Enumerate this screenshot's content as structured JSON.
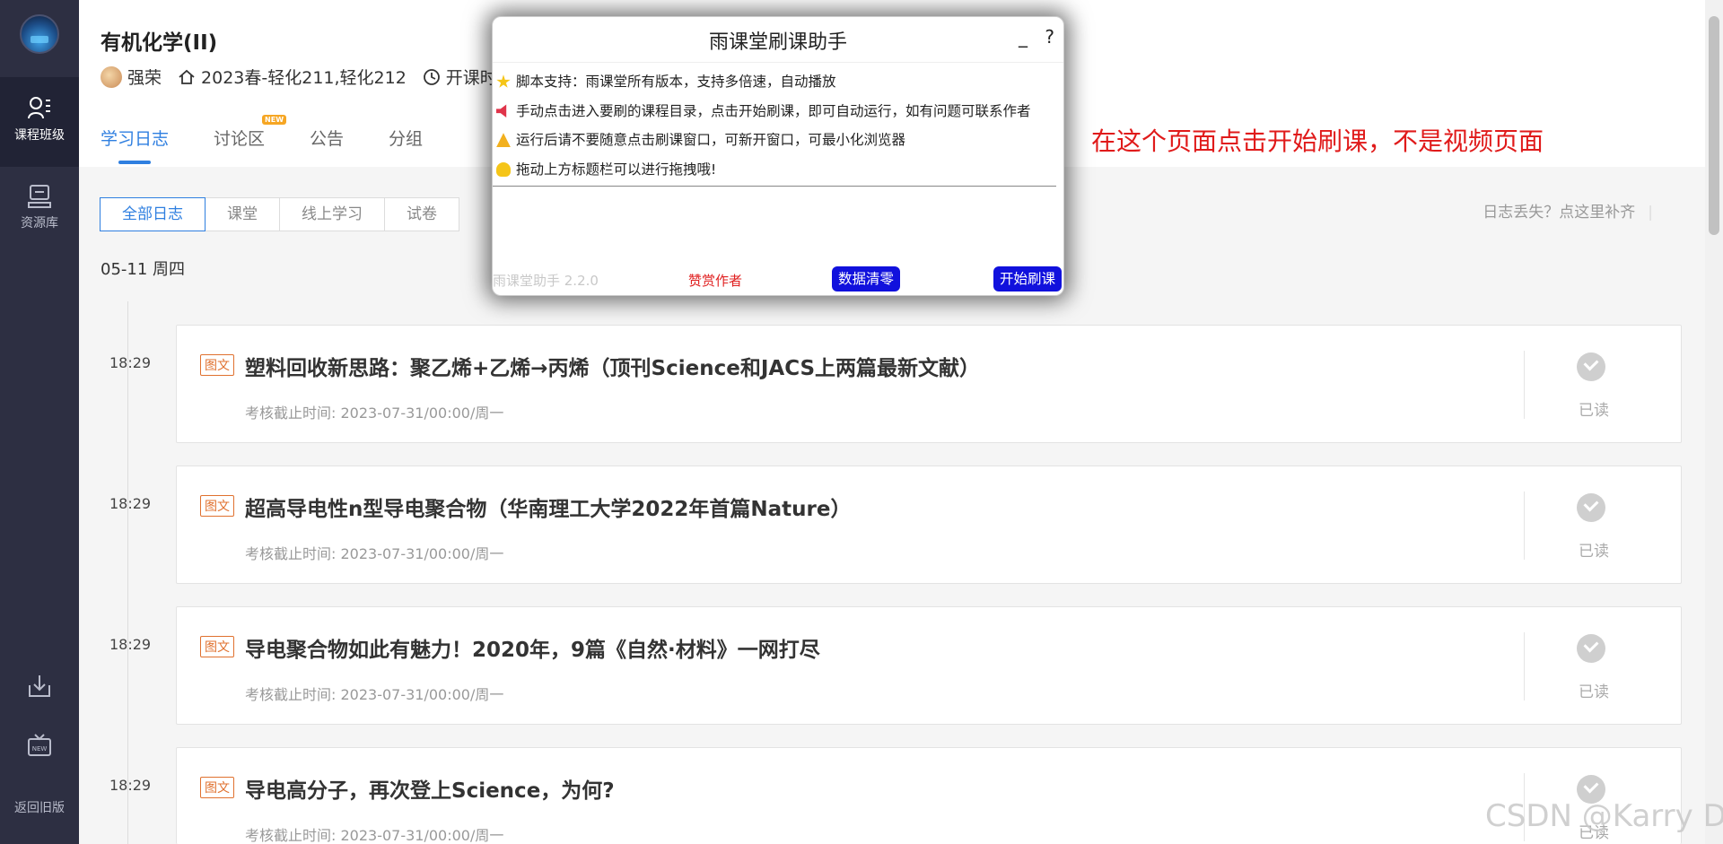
{
  "sidebar": {
    "items": [
      {
        "label": "课程班级",
        "icon": "class-icon"
      },
      {
        "label": "资源库",
        "icon": "resource-icon"
      },
      {
        "label": "",
        "icon": "download-icon"
      },
      {
        "label": "",
        "icon": "new-icon"
      },
      {
        "label": "返回旧版",
        "icon": ""
      }
    ]
  },
  "header": {
    "course_title": "有机化学(II)",
    "teacher": "强荣",
    "classes": "2023春-轻化211,轻化212",
    "status": "开课时"
  },
  "tabs": [
    "学习日志",
    "讨论区",
    "公告",
    "分组"
  ],
  "tab_badge": "NEW",
  "filters": [
    "全部日志",
    "课堂",
    "线上学习",
    "试卷"
  ],
  "lost_link": "日志丢失？点这里补齐",
  "date_label": "05-11 周四",
  "entries": [
    {
      "time": "18:29",
      "tag": "图文",
      "title": "塑料回收新思路：聚乙烯+乙烯→丙烯（顶刊Science和JACS上两篇最新文献）",
      "deadline": "考核截止时间:   2023-07-31/00:00/周一",
      "status": "已读"
    },
    {
      "time": "18:29",
      "tag": "图文",
      "title": "超高导电性n型导电聚合物（华南理工大学2022年首篇Nature）",
      "deadline": "考核截止时间:   2023-07-31/00:00/周一",
      "status": "已读"
    },
    {
      "time": "18:29",
      "tag": "图文",
      "title": "导电聚合物如此有魅力！2020年，9篇《自然·材料》一网打尽",
      "deadline": "考核截止时间:   2023-07-31/00:00/周一",
      "status": "已读"
    },
    {
      "time": "18:29",
      "tag": "图文",
      "title": "导电高分子，再次登上Science，为何?",
      "deadline": "考核截止时间:   2023-07-31/00:00/周一",
      "status": "已读"
    }
  ],
  "popup": {
    "title": "雨课堂刷课助手",
    "min_label": "_",
    "help_label": "?",
    "lines": [
      "脚本支持：雨课堂所有版本，支持多倍速，自动播放",
      "手动点击进入要刷的课程目录，点击开始刷课，即可自动运行，如有问题可联系作者",
      "运行后请不要随意点击刷课窗口，可新开窗口，可最小化浏览器",
      "拖动上方标题栏可以进行拖拽哦!"
    ],
    "version": "雨课堂助手 2.2.0",
    "support": "赞赏作者",
    "clear_btn": "数据清零",
    "start_btn": "开始刷课"
  },
  "annotation": "在这个页面点击开始刷课，不是视频页面",
  "watermark": "CSDN @Karry D",
  "colors": {
    "accent": "#2f7fe0",
    "sidebar": "#2d2f42",
    "tag": "#e0712f",
    "popup_btn": "#1111dd",
    "annotation": "#e01a1a"
  }
}
